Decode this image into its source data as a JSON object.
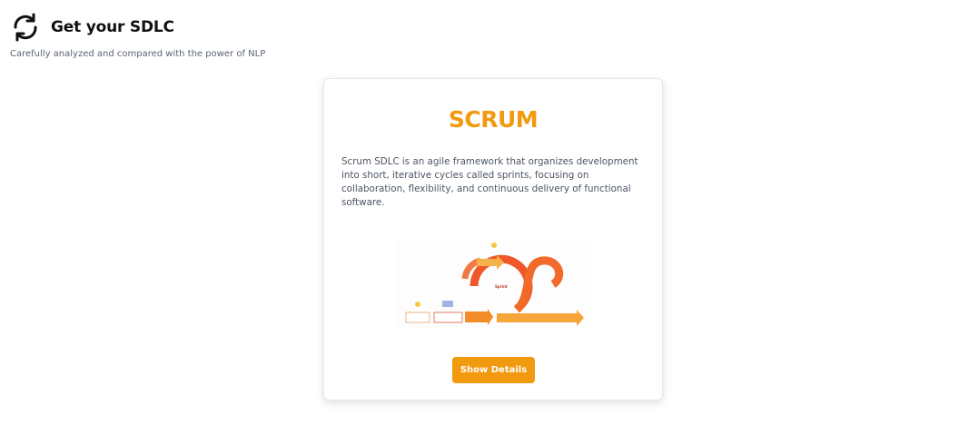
{
  "header": {
    "icon": "refresh-cycle-icon",
    "title": "Get your SDLC",
    "subtitle": "Carefully analyzed and compared with the power of NLP"
  },
  "card": {
    "title": "SCRUM",
    "description": "Scrum SDLC is an agile framework that organizes development into short, iterative cycles called sprints, focusing on collaboration, flexibility, and continuous delivery of functional software.",
    "diagram_center_label": "Sprint",
    "button_label": "Show Details"
  },
  "colors": {
    "accent": "#f29a0e",
    "title_text": "#111111",
    "body_text": "#4b5563",
    "sprint_red": "#f0582a",
    "sprint_orange": "#f59a2e"
  }
}
